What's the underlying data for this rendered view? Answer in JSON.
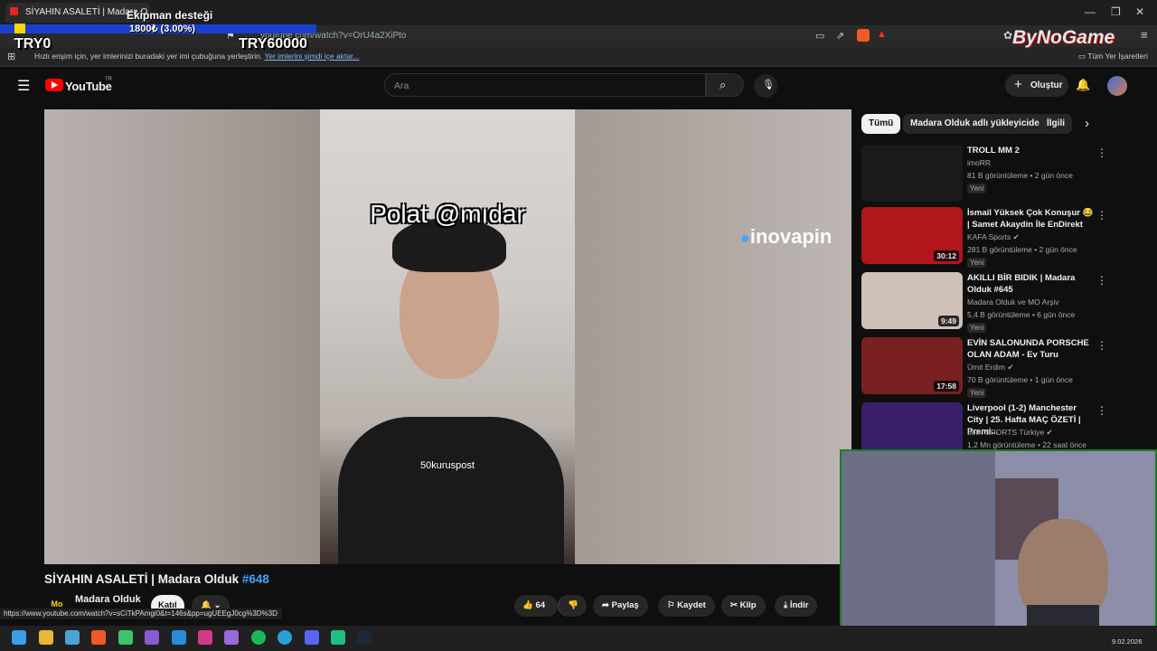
{
  "browser": {
    "tab_title": "SİYAHIN ASALETİ | Madara O",
    "url": "youtube.com/watch?v=OrU4a2XiPto",
    "bookmark_text": "Hızlı erişim için, yer imlerinizi buradaki yer imi çubuğuna yerleştirin.",
    "bookmark_link": "Yer imlerini şimdi içe aktar...",
    "bookmark_folder": "Tüm Yer İşaretleri"
  },
  "donation": {
    "title": "Ekipman desteği",
    "amount": "1800₺ (3.00%)",
    "progress": 0.03,
    "min": "TRY0",
    "max": "TRY60000",
    "brand": "ByNoGame"
  },
  "youtube": {
    "logo": "YouTube",
    "country": "TR",
    "search_placeholder": "Ara",
    "create": "Oluştur"
  },
  "player": {
    "overlay": "Polat @mıdar",
    "watermark": "50kuruspost",
    "brand_overlay": "inovapin"
  },
  "chips": [
    "Tümü",
    "Madara Olduk adlı yükleyiciden",
    "İlgili"
  ],
  "recs": [
    {
      "title": "TROLL MM 2",
      "channel": "imoRR",
      "meta": "81 B görüntüleme • 2 gün önce",
      "badge": "Yeni",
      "duration": "",
      "color": "#1a1a1a"
    },
    {
      "title": "İsmail Yüksek Çok Konuşur 😂 | Samet Akaydin İle EnDirekt",
      "channel": "KAFA Sports ✔",
      "meta": "281 B görüntüleme • 2 gün önce",
      "badge": "Yeni",
      "duration": "30:12",
      "color": "#b0161c"
    },
    {
      "title": "AKILLI BİR BIDIK | Madara Olduk #645",
      "channel": "Madara Olduk ve MO Arşiv",
      "meta": "5,4 B görüntüleme • 6 gün önce",
      "badge": "Yeni",
      "duration": "9:49",
      "color": "#cfc1b7"
    },
    {
      "title": "EVİN SALONUNDA PORSCHE OLAN ADAM - Ev Turu",
      "channel": "Ümit Erdim ✔",
      "meta": "70 B görüntüleme • 1 gün önce",
      "badge": "Yeni",
      "duration": "17:58",
      "color": "#7a2020"
    },
    {
      "title": "Liverpool (1-2) Manchester City | 25. Hafta MAÇ ÖZETİ | Premi...",
      "channel": "beIN SPORTS Türkiye ✔",
      "meta": "1,2 Mn görüntüleme • 22 saat önce",
      "badge": "",
      "duration": "",
      "color": "#3a1f6a"
    }
  ],
  "video": {
    "title": "SİYAHIN ASALETİ | Madara Olduk",
    "tag": "#648",
    "channel": "Madara Olduk",
    "channel_avatar": "Mo",
    "join": "Katıl",
    "likes": "64",
    "share": "Paylaş",
    "save": "Kaydet",
    "clip": "Klip",
    "download": "İndir"
  },
  "status_url": "https://www.youtube.com/watch?v=sCiTkPAmgi0&t=146s&pp=ugUEEgJ0cg%3D%3D",
  "taskbar": {
    "date": "9.02.2026"
  }
}
